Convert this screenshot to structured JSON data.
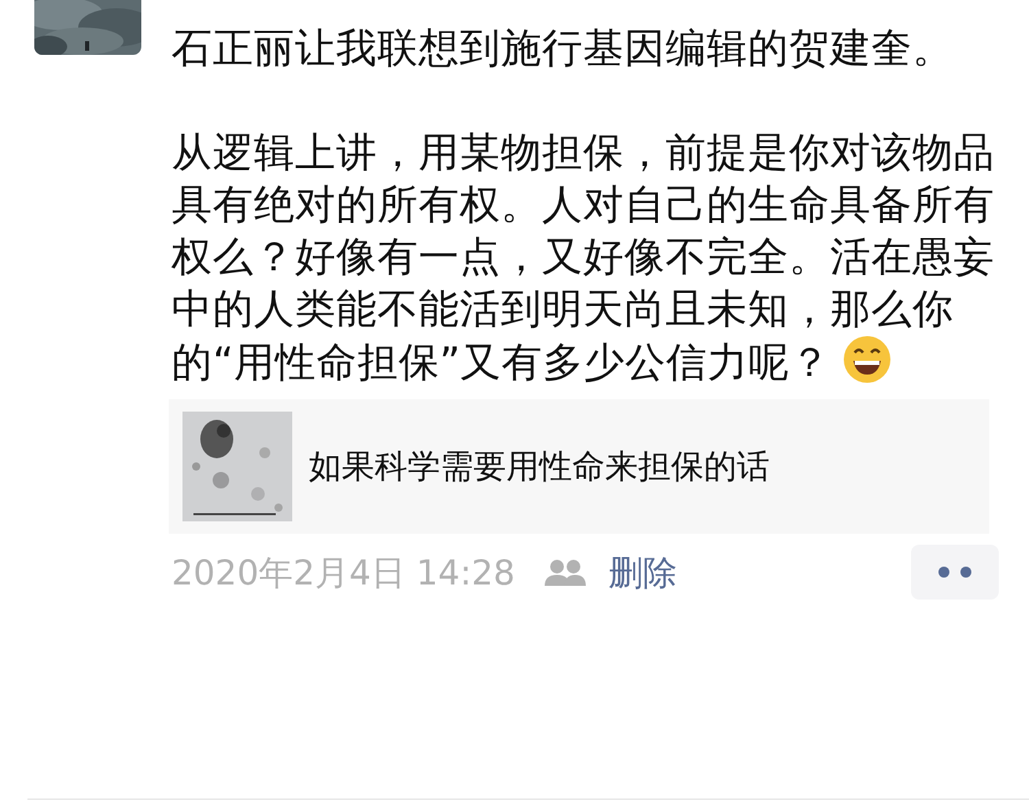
{
  "post": {
    "paragraphs": [
      "石正丽让我联想到施行基因编辑的贺建奎。",
      "从逻辑上讲，用某物担保，前提是你对该物品具有绝对的所有权。人对自己的生命具备所有权么？好像有一点，又好像不完全。活在愚妄中的人类能不能活到明天尚且未知，那么你的“用性命担保”又有多少公信力呢？"
    ],
    "link_card": {
      "title": "如果科学需要用性命来担保的话"
    },
    "footer": {
      "time": "2020年2月4日 14:28",
      "delete_link": "删除"
    }
  }
}
